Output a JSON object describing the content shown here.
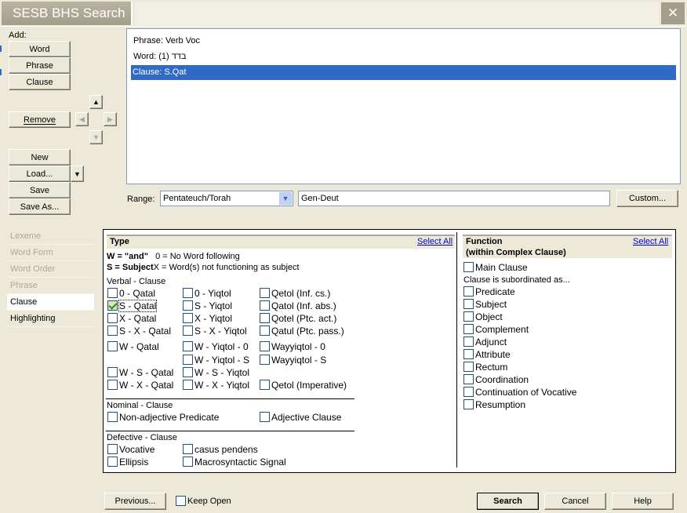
{
  "window": {
    "title": "SESB BHS Search",
    "close_glyph": "✕"
  },
  "add": {
    "label": "Add:",
    "buttons": [
      "Word",
      "Phrase",
      "Clause"
    ]
  },
  "remove_label": "Remove",
  "file_buttons": {
    "new": "New",
    "load": "Load...",
    "save": "Save",
    "save_as": "Save As..."
  },
  "sidebar": {
    "items": [
      {
        "label": "Lexeme"
      },
      {
        "label": "Word Form"
      },
      {
        "label": "Word Order"
      },
      {
        "label": "Phrase"
      },
      {
        "label": "Clause"
      },
      {
        "label": "Highlighting"
      }
    ]
  },
  "query_list": [
    "Phrase: Verb Voc",
    "Word: (1) בדד",
    "Clause: S.Qat"
  ],
  "range": {
    "label": "Range:",
    "selected": "Pentateuch/Torah",
    "text": "Gen-Deut",
    "custom_button": "Custom..."
  },
  "type_panel": {
    "header": "Type",
    "select_all": "Select All",
    "legend_line1_a": "W = \"and\"",
    "legend_line1_b": "0 = No Word following",
    "legend_line2_a": "S = Subject",
    "legend_line2_b": "X = Word(s) not functioning as subject",
    "verbal_heading": "Verbal - Clause",
    "verbal_options": [
      {
        "label": "0 - Qatal",
        "checked": false
      },
      {
        "label": "0 - Yiqtol",
        "checked": false
      },
      {
        "label": "Qetol (Inf. cs.)",
        "checked": false
      },
      {
        "label": "S - Qatal",
        "checked": true
      },
      {
        "label": "S - Yiqtol",
        "checked": false
      },
      {
        "label": "Qatol (Inf. abs.)",
        "checked": false
      },
      {
        "label": "X - Qatal",
        "checked": false
      },
      {
        "label": "X - Yiqtol",
        "checked": false
      },
      {
        "label": "Qotel (Ptc. act.)",
        "checked": false
      },
      {
        "label": "S - X - Qatal",
        "checked": false
      },
      {
        "label": "S - X - Yiqtol",
        "checked": false
      },
      {
        "label": "Qatul (Ptc. pass.)",
        "checked": false
      },
      {
        "label": "W - Qatal",
        "checked": false
      },
      {
        "label": "W - Yiqtol - 0",
        "checked": false
      },
      {
        "label": "Wayyiqtol - 0",
        "checked": false
      },
      {
        "label": "W - Yiqtol - S",
        "checked": false
      },
      {
        "label": "Wayyiqtol - S",
        "checked": false
      },
      {
        "label": "W - S - Qatal",
        "checked": false
      },
      {
        "label": "W - S - Yiqtol",
        "checked": false
      },
      {
        "label": "W - X - Qatal",
        "checked": false
      },
      {
        "label": "W - X - Yiqtol",
        "checked": false
      },
      {
        "label": "Qetol (Imperative)",
        "checked": false
      }
    ],
    "nominal_heading": "Nominal - Clause",
    "nominal_options": [
      {
        "label": "Non-adjective Predicate",
        "checked": false
      },
      {
        "label": "Adjective Clause",
        "checked": false
      }
    ],
    "defective_heading": "Defective - Clause",
    "defective_options": [
      {
        "label": "Vocative",
        "checked": false
      },
      {
        "label": "casus pendens",
        "checked": false
      },
      {
        "label": "Ellipsis",
        "checked": false
      },
      {
        "label": "Macrosyntactic Signal",
        "checked": false
      }
    ]
  },
  "function_panel": {
    "header_line1": "Function",
    "header_line2": "(within Complex Clause)",
    "select_all": "Select All",
    "main_clause": "Main Clause",
    "subordinate_label": "Clause is subordinated as...",
    "options": [
      "Predicate",
      "Subject",
      "Object",
      "Complement",
      "Adjunct",
      "Attribute",
      "Rectum",
      "Coordination",
      "Continuation of Vocative",
      "Resumption"
    ]
  },
  "footer": {
    "previous": "Previous...",
    "keep_open": "Keep Open",
    "search": "Search",
    "cancel": "Cancel",
    "help": "Help"
  }
}
